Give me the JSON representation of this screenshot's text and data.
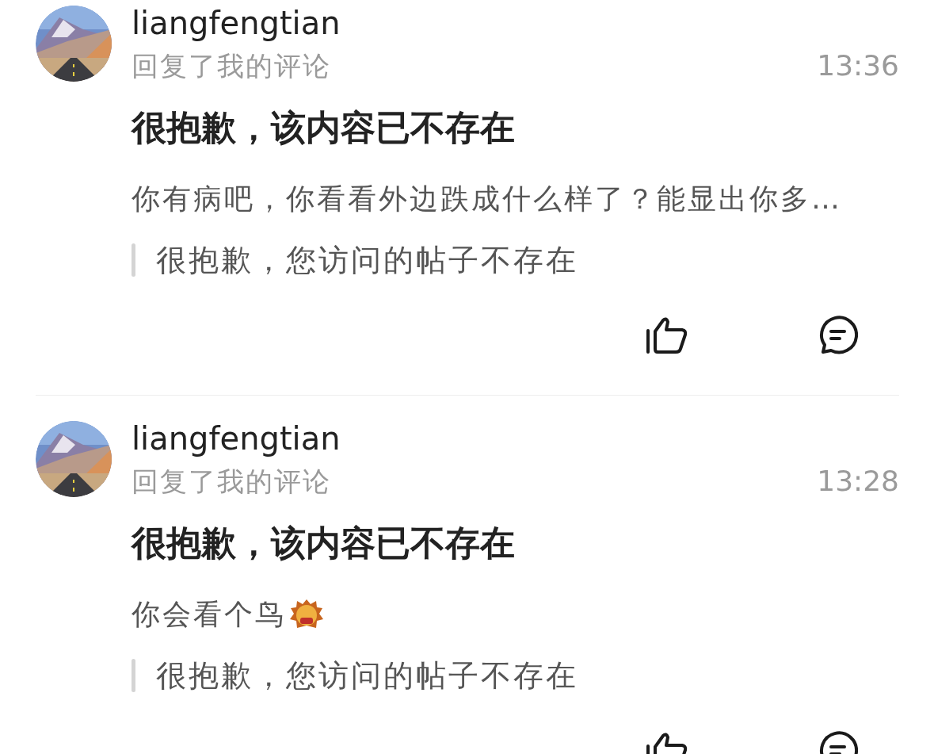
{
  "notifications": [
    {
      "user": "liangfengtian",
      "action": "回复了我的评论",
      "time": "13:36",
      "title": "很抱歉，该内容已不存在",
      "body": "你有病吧，你看看外边跌成什么样了？能显出你多…",
      "emoji": false,
      "quote": "很抱歉，您访问的帖子不存在"
    },
    {
      "user": "liangfengtian",
      "action": "回复了我的评论",
      "time": "13:28",
      "title": "很抱歉，该内容已不存在",
      "body": "你会看个鸟",
      "emoji": true,
      "quote": "很抱歉，您访问的帖子不存在"
    }
  ]
}
